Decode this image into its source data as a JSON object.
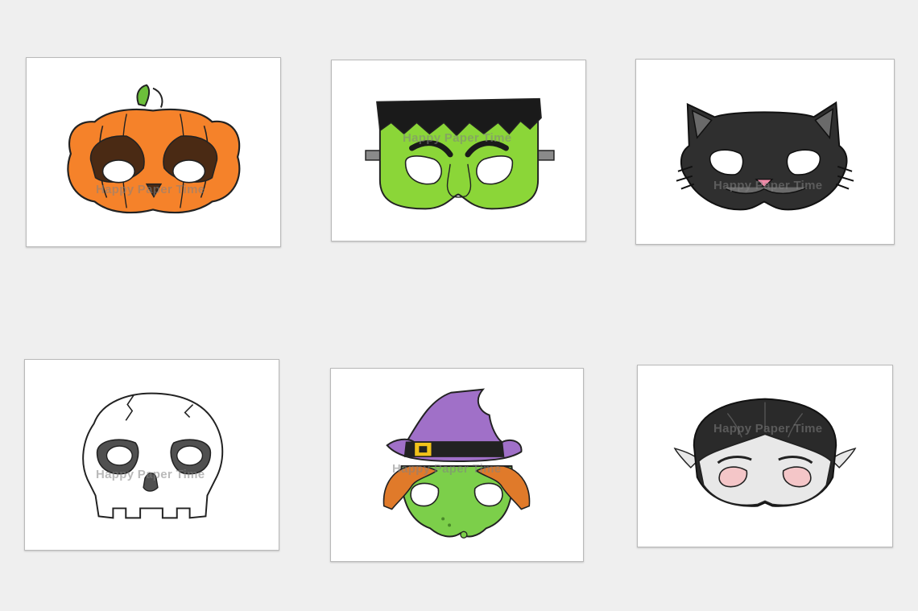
{
  "watermark": "Happy Paper Time",
  "masks": [
    {
      "name": "pumpkin",
      "colors": {
        "main": "#f5822a",
        "stem": "#6cbf3a",
        "dark": "#4a2a14"
      }
    },
    {
      "name": "frankenstein",
      "colors": {
        "skin": "#8bd638",
        "hair": "#1a1a1a",
        "bolt": "#8a8a8a"
      }
    },
    {
      "name": "black-cat",
      "colors": {
        "fur": "#2f2f2f",
        "ear": "#6a6a6a",
        "nose": "#f08aa8"
      }
    },
    {
      "name": "skull",
      "colors": {
        "bone": "#ffffff",
        "outline": "#222222"
      }
    },
    {
      "name": "witch",
      "colors": {
        "hat": "#a070c8",
        "band": "#222222",
        "buckle": "#f2c21a",
        "hair": "#e07a2a",
        "skin": "#7ccf4a"
      }
    },
    {
      "name": "vampire",
      "colors": {
        "hair": "#2a2a2a",
        "skin": "#e8e8e8",
        "lining": "#f4c6c8"
      }
    }
  ]
}
